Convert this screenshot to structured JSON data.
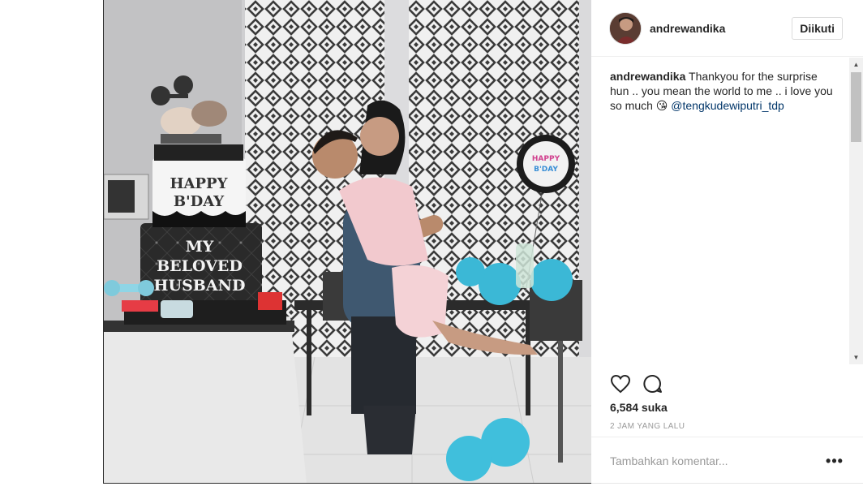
{
  "post": {
    "username": "andrewandika",
    "follow_label": "Diikuti",
    "caption": {
      "username": "andrewandika",
      "text": "Thankyou for the surprise hun .. you mean the world to me .. i love you so much 😘",
      "mention": "@tengkudewiputri_tdp"
    },
    "likes": "6,584 suka",
    "timestamp": "2 JAM YANG LALU",
    "comment_placeholder": "Tambahkan komentar...",
    "more_label": "•••"
  },
  "photo": {
    "cake_text_top": [
      "HAPPY",
      "B'DAY"
    ],
    "cake_text_bottom": [
      "MY",
      "BELOVED",
      "HUSBAND"
    ],
    "balloon_text": [
      "HAPPY",
      "B'DAY"
    ]
  },
  "icons": {
    "like": "heart-icon",
    "comment": "speech-bubble-icon",
    "more": "ellipsis-icon"
  },
  "colors": {
    "link": "#003569",
    "muted": "#999999",
    "text": "#262626"
  }
}
